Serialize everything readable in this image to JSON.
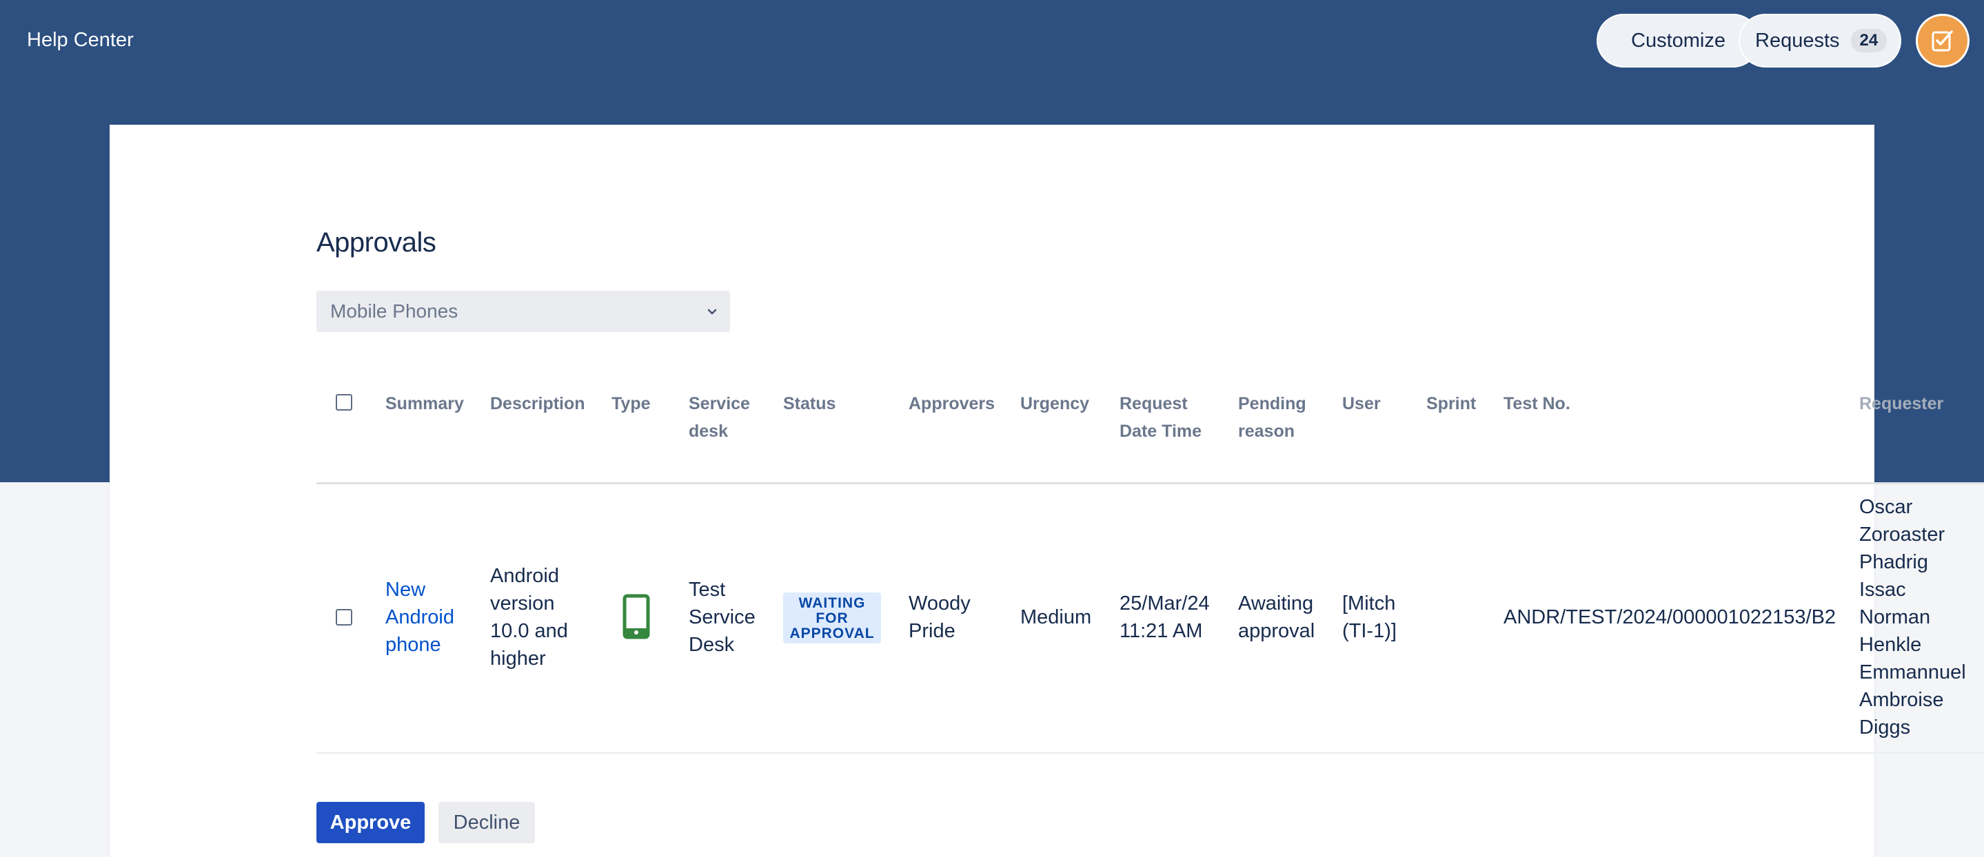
{
  "header": {
    "help_center": "Help Center",
    "customize": "Customize",
    "requests_label": "Requests",
    "requests_count": "24",
    "avatar_icon": "approval-checklist-icon"
  },
  "page": {
    "title": "Approvals",
    "filter_selected": "Mobile Phones"
  },
  "table": {
    "columns": {
      "summary": "Summary",
      "description": "Description",
      "type": "Type",
      "service_desk_1": "Service",
      "service_desk_2": "desk",
      "status": "Status",
      "approvers": "Approvers",
      "urgency": "Urgency",
      "request_dt_1": "Request",
      "request_dt_2": "Date Time",
      "pending_1": "Pending",
      "pending_2": "reason",
      "user": "User",
      "sprint": "Sprint",
      "test_no": "Test No.",
      "requester": "Requester"
    },
    "rows": [
      {
        "summary": [
          "New",
          "Android",
          "phone"
        ],
        "description": [
          "Android",
          "version",
          "10.0 and",
          "higher"
        ],
        "type_icon": "mobile-phone-icon",
        "service_desk": [
          "Test",
          "Service",
          "Desk"
        ],
        "status": [
          "WAITING",
          "FOR",
          "APPROVAL"
        ],
        "approvers": [
          "Woody",
          "Pride"
        ],
        "urgency": "Medium",
        "request_dt": [
          "25/Mar/24",
          "11:21 AM"
        ],
        "pending_reason": [
          "Awaiting",
          "approval"
        ],
        "user": [
          "[Mitch",
          "(TI-1)]"
        ],
        "sprint": "",
        "test_no": "ANDR/TEST/2024/000001022153/B2",
        "requester": [
          "Oscar",
          "Zoroaster",
          "Phadrig",
          "Issac",
          "Norman",
          "Henkle",
          "Emmannuel",
          "Ambroise",
          "Diggs"
        ]
      }
    ]
  },
  "actions": {
    "approve": "Approve",
    "decline": "Decline"
  },
  "colors": {
    "banner": "#2d5080",
    "link": "#0052cc",
    "primary_button": "#1f4fc2",
    "status_bg": "#deebff",
    "status_text": "#0747a6",
    "avatar": "#f0a04a",
    "phone_icon": "#36873f"
  }
}
